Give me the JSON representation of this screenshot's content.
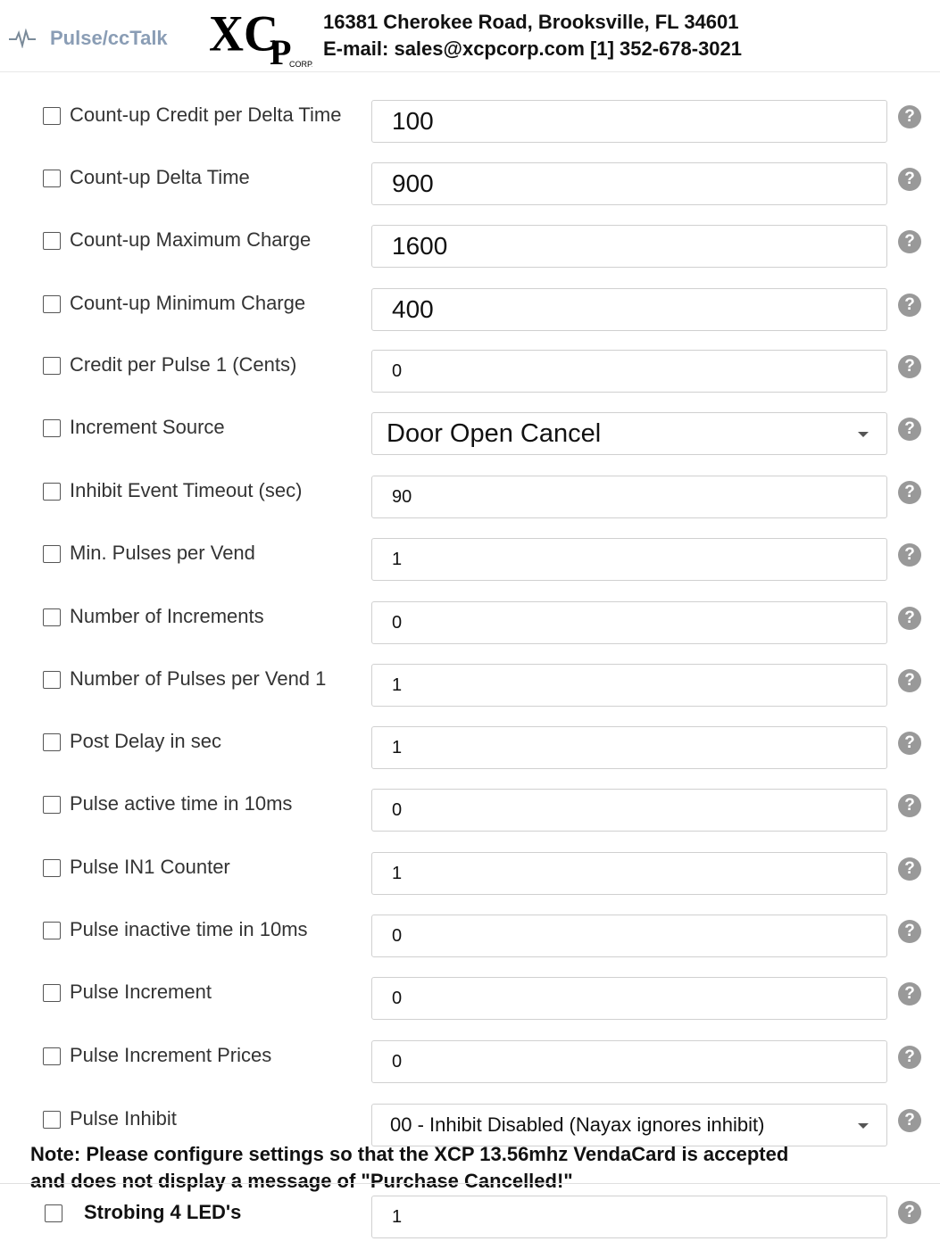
{
  "header": {
    "tab_label": "Pulse/ccTalk",
    "tab_icon": "pulse-wave-icon",
    "logo_text": "XCP",
    "logo_sub": "CORP.",
    "address": "16381 Cherokee Road, Brooksville, FL 34601",
    "contact": "E-mail:  sales@xcpcorp.com  [1] 352-678-3021"
  },
  "help_glyph": "?",
  "settings": [
    {
      "label": "Count-up Credit per Delta Time",
      "value": "100",
      "type": "text",
      "checked": false
    },
    {
      "label": "Count-up Delta Time",
      "value": "900",
      "type": "text",
      "checked": false
    },
    {
      "label": "Count-up Maximum Charge",
      "value": "1600",
      "type": "text",
      "checked": false
    },
    {
      "label": "Count-up Minimum Charge",
      "value": "400",
      "type": "text",
      "checked": false
    },
    {
      "label": "Credit per Pulse 1 (Cents)",
      "value": "0",
      "type": "text",
      "checked": false
    },
    {
      "label": "Increment Source",
      "value": "Door Open Cancel",
      "type": "select",
      "checked": false
    },
    {
      "label": "Inhibit Event Timeout (sec)",
      "value": "90",
      "type": "text",
      "checked": false
    },
    {
      "label": "Min. Pulses per Vend",
      "value": "1",
      "type": "text",
      "checked": false
    },
    {
      "label": "Number of Increments",
      "value": "0",
      "type": "text",
      "checked": false
    },
    {
      "label": "Number of Pulses per Vend 1",
      "value": "1",
      "type": "text",
      "checked": false
    },
    {
      "label": "Post Delay in sec",
      "value": "1",
      "type": "text",
      "checked": false
    },
    {
      "label": "Pulse active time in 10ms",
      "value": "0",
      "type": "text",
      "checked": false
    },
    {
      "label": "Pulse IN1 Counter",
      "value": "1",
      "type": "text",
      "checked": false
    },
    {
      "label": "Pulse inactive time in 10ms",
      "value": "0",
      "type": "text",
      "checked": false
    },
    {
      "label": "Pulse Increment",
      "value": "0",
      "type": "text",
      "checked": false
    },
    {
      "label": "Pulse Increment Prices",
      "value": "0",
      "type": "text",
      "checked": false
    },
    {
      "label": "Pulse Inhibit",
      "value": "00 - Inhibit Disabled (Nayax ignores inhibit)",
      "type": "select",
      "checked": false
    }
  ],
  "note": {
    "line1": "Note:  Please configure settings so that the XCP 13.56mhz VendaCard is accepted",
    "line2": "and does not display a message of \"Purchase Cancelled!\""
  },
  "last_setting": {
    "label": "Strobing 4 LED's",
    "value": "1",
    "type": "text",
    "checked": false
  }
}
